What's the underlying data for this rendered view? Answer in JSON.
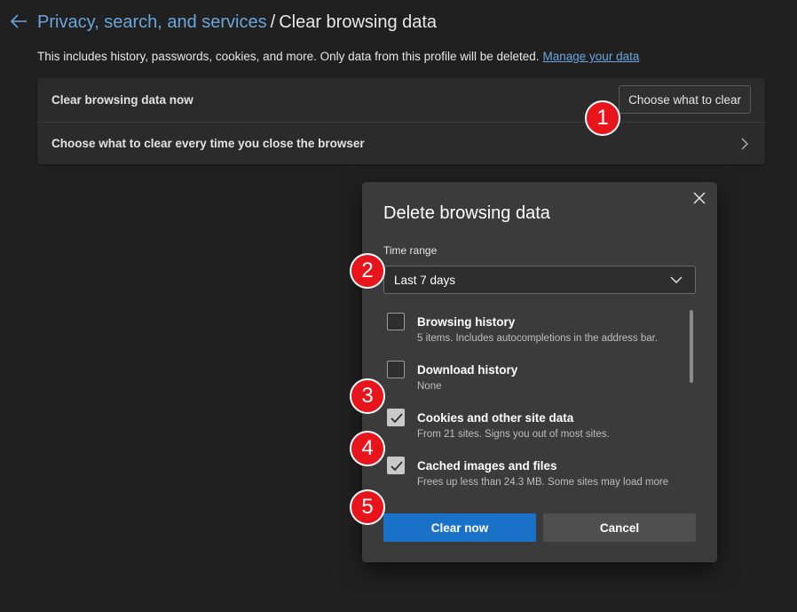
{
  "header": {
    "breadcrumb_parent": "Privacy, search, and services",
    "breadcrumb_separator": "/",
    "breadcrumb_current": "Clear browsing data"
  },
  "description": {
    "text": "This includes history, passwords, cookies, and more. Only data from this profile will be deleted.",
    "link": "Manage your data"
  },
  "card": {
    "row1_label": "Clear browsing data now",
    "row1_button": "Choose what to clear",
    "row2_label": "Choose what to clear every time you close the browser"
  },
  "dialog": {
    "title": "Delete browsing data",
    "time_range_label": "Time range",
    "time_range_value": "Last 7 days",
    "items": [
      {
        "title": "Browsing history",
        "subtitle": "5 items. Includes autocompletions in the address bar.",
        "checked": false
      },
      {
        "title": "Download history",
        "subtitle": "None",
        "checked": false
      },
      {
        "title": "Cookies and other site data",
        "subtitle": "From 21 sites. Signs you out of most sites.",
        "checked": true
      },
      {
        "title": "Cached images and files",
        "subtitle": "Frees up less than 24.3 MB. Some sites may load more",
        "checked": true
      }
    ],
    "primary_button": "Clear now",
    "secondary_button": "Cancel"
  },
  "annotations": [
    "1",
    "2",
    "3",
    "4",
    "5"
  ],
  "colors": {
    "background": "#202020",
    "link": "#6aa6dc",
    "primary": "#1a72c8",
    "badge": "#e8141c"
  }
}
